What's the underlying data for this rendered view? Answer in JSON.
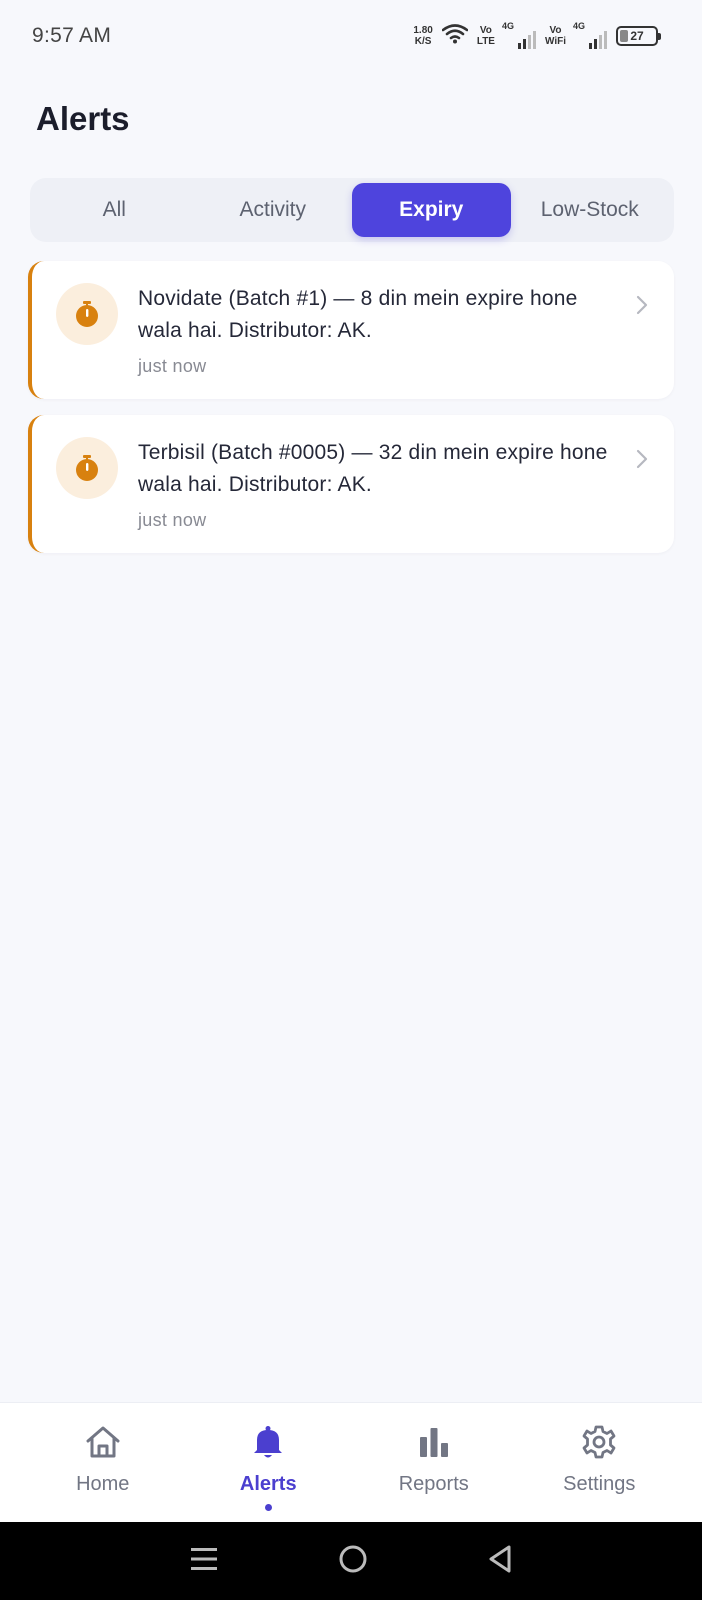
{
  "status_bar": {
    "time": "9:57 AM",
    "net_speed_value": "1.80",
    "net_speed_unit": "K/S",
    "volte_top": "Vo",
    "volte_bottom": "LTE",
    "sim1_label": "4G",
    "vowifi_top": "Vo",
    "vowifi_bottom": "WiFi",
    "sim2_label": "4G",
    "battery": "27"
  },
  "page": {
    "title": "Alerts"
  },
  "tabs": [
    {
      "label": "All",
      "active": false
    },
    {
      "label": "Activity",
      "active": false
    },
    {
      "label": "Expiry",
      "active": true
    },
    {
      "label": "Low-Stock",
      "active": false
    }
  ],
  "alerts": [
    {
      "icon": "stopwatch-icon",
      "message": "Novidate (Batch #1) — 8 din mein expire hone wala hai. Distributor: AK.",
      "time": "just now"
    },
    {
      "icon": "stopwatch-icon",
      "message": "Terbisil (Batch #0005) — 32 din mein expire hone wala hai. Distributor: AK.",
      "time": "just now"
    }
  ],
  "bottom_nav": [
    {
      "label": "Home",
      "icon": "home-icon",
      "active": false
    },
    {
      "label": "Alerts",
      "icon": "bell-icon",
      "active": true
    },
    {
      "label": "Reports",
      "icon": "bar-chart-icon",
      "active": false
    },
    {
      "label": "Settings",
      "icon": "gear-icon",
      "active": false
    }
  ],
  "colors": {
    "accent": "#4e44dd",
    "expiry_accent": "#d8810f",
    "background": "#f7f8fc"
  }
}
